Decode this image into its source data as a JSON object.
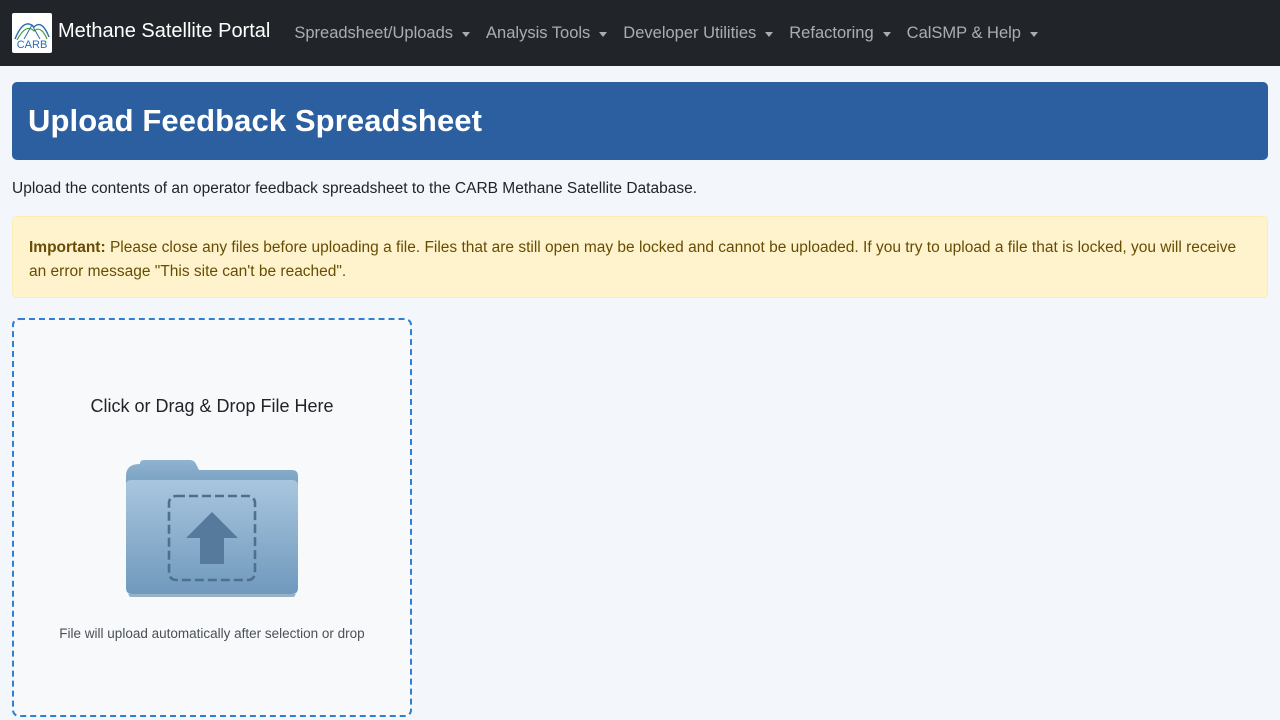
{
  "navbar": {
    "logo_text": "CARB",
    "brand": "Methane Satellite Portal",
    "menus": [
      {
        "label": "Spreadsheet/Uploads"
      },
      {
        "label": "Analysis Tools"
      },
      {
        "label": "Developer Utilities"
      },
      {
        "label": "Refactoring"
      },
      {
        "label": "CalSMP & Help"
      }
    ]
  },
  "page": {
    "title": "Upload Feedback Spreadsheet",
    "description": "Upload the contents of an operator feedback spreadsheet to the CARB Methane Satellite Database."
  },
  "alert": {
    "label": "Important:",
    "message": " Please close any files before uploading a file. Files that are still open may be locked and cannot be uploaded. If you try to upload a file that is locked, you will receive an error message \"This site can't be reached\"."
  },
  "dropzone": {
    "title": "Click or Drag & Drop File Here",
    "icon": "folder-upload-icon",
    "note": "File will upload automatically after selection or drop"
  },
  "colors": {
    "navbar_bg": "#212529",
    "banner_bg": "#2c5f9f",
    "alert_bg": "#fff3cd",
    "dropzone_border": "#2f7fd4",
    "page_bg": "#f3f6fa"
  }
}
